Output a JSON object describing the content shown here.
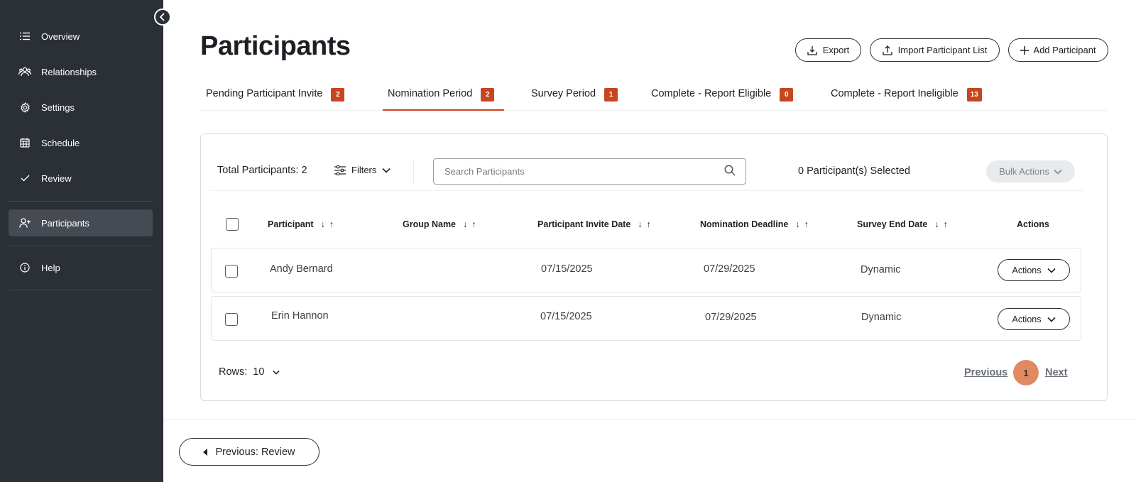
{
  "sidebar": {
    "items": [
      {
        "label": "Overview",
        "icon": "list-icon"
      },
      {
        "label": "Relationships",
        "icon": "people-icon"
      },
      {
        "label": "Settings",
        "icon": "gear-icon"
      },
      {
        "label": "Schedule",
        "icon": "calendar-icon"
      },
      {
        "label": "Review",
        "icon": "check-icon"
      },
      {
        "label": "Participants",
        "icon": "add-person-icon",
        "active": true
      },
      {
        "label": "Help",
        "icon": "info-icon"
      }
    ]
  },
  "header": {
    "title": "Participants",
    "export_label": "Export",
    "import_label": "Import Participant List",
    "add_label": "Add Participant"
  },
  "tabs": [
    {
      "label": "Pending Participant Invite",
      "count": "2"
    },
    {
      "label": "Nomination Period",
      "count": "2",
      "active": true
    },
    {
      "label": "Survey Period",
      "count": "1"
    },
    {
      "label": "Complete - Report Eligible",
      "count": "0"
    },
    {
      "label": "Complete - Report Ineligible",
      "count": "13"
    }
  ],
  "toolbar": {
    "total": "Total Participants: 2",
    "filters_label": "Filters",
    "search_placeholder": "Search Participants",
    "selected": "0 Participant(s) Selected",
    "bulk_label": "Bulk Actions"
  },
  "table": {
    "columns": [
      "Participant",
      "Group Name",
      "Participant Invite Date",
      "Nomination Deadline",
      "Survey End Date",
      "Actions"
    ],
    "rows": [
      {
        "participant": "Andy Bernard",
        "group": "",
        "invite_date": "07/15/2025",
        "deadline": "07/29/2025",
        "survey_end": "Dynamic",
        "action_label": "Actions"
      },
      {
        "participant": "Erin Hannon",
        "group": "",
        "invite_date": "07/15/2025",
        "deadline": "07/29/2025",
        "survey_end": "Dynamic",
        "action_label": "Actions"
      }
    ]
  },
  "pagination": {
    "rows_label": "Rows:",
    "rows_value": "10",
    "previous": "Previous",
    "page": "1",
    "next": "Next"
  },
  "footer": {
    "prev_label": "Previous: Review"
  },
  "colors": {
    "sidebar_bg": "#2b2f36",
    "accent": "#c7461f",
    "page_active": "#e08a62"
  }
}
